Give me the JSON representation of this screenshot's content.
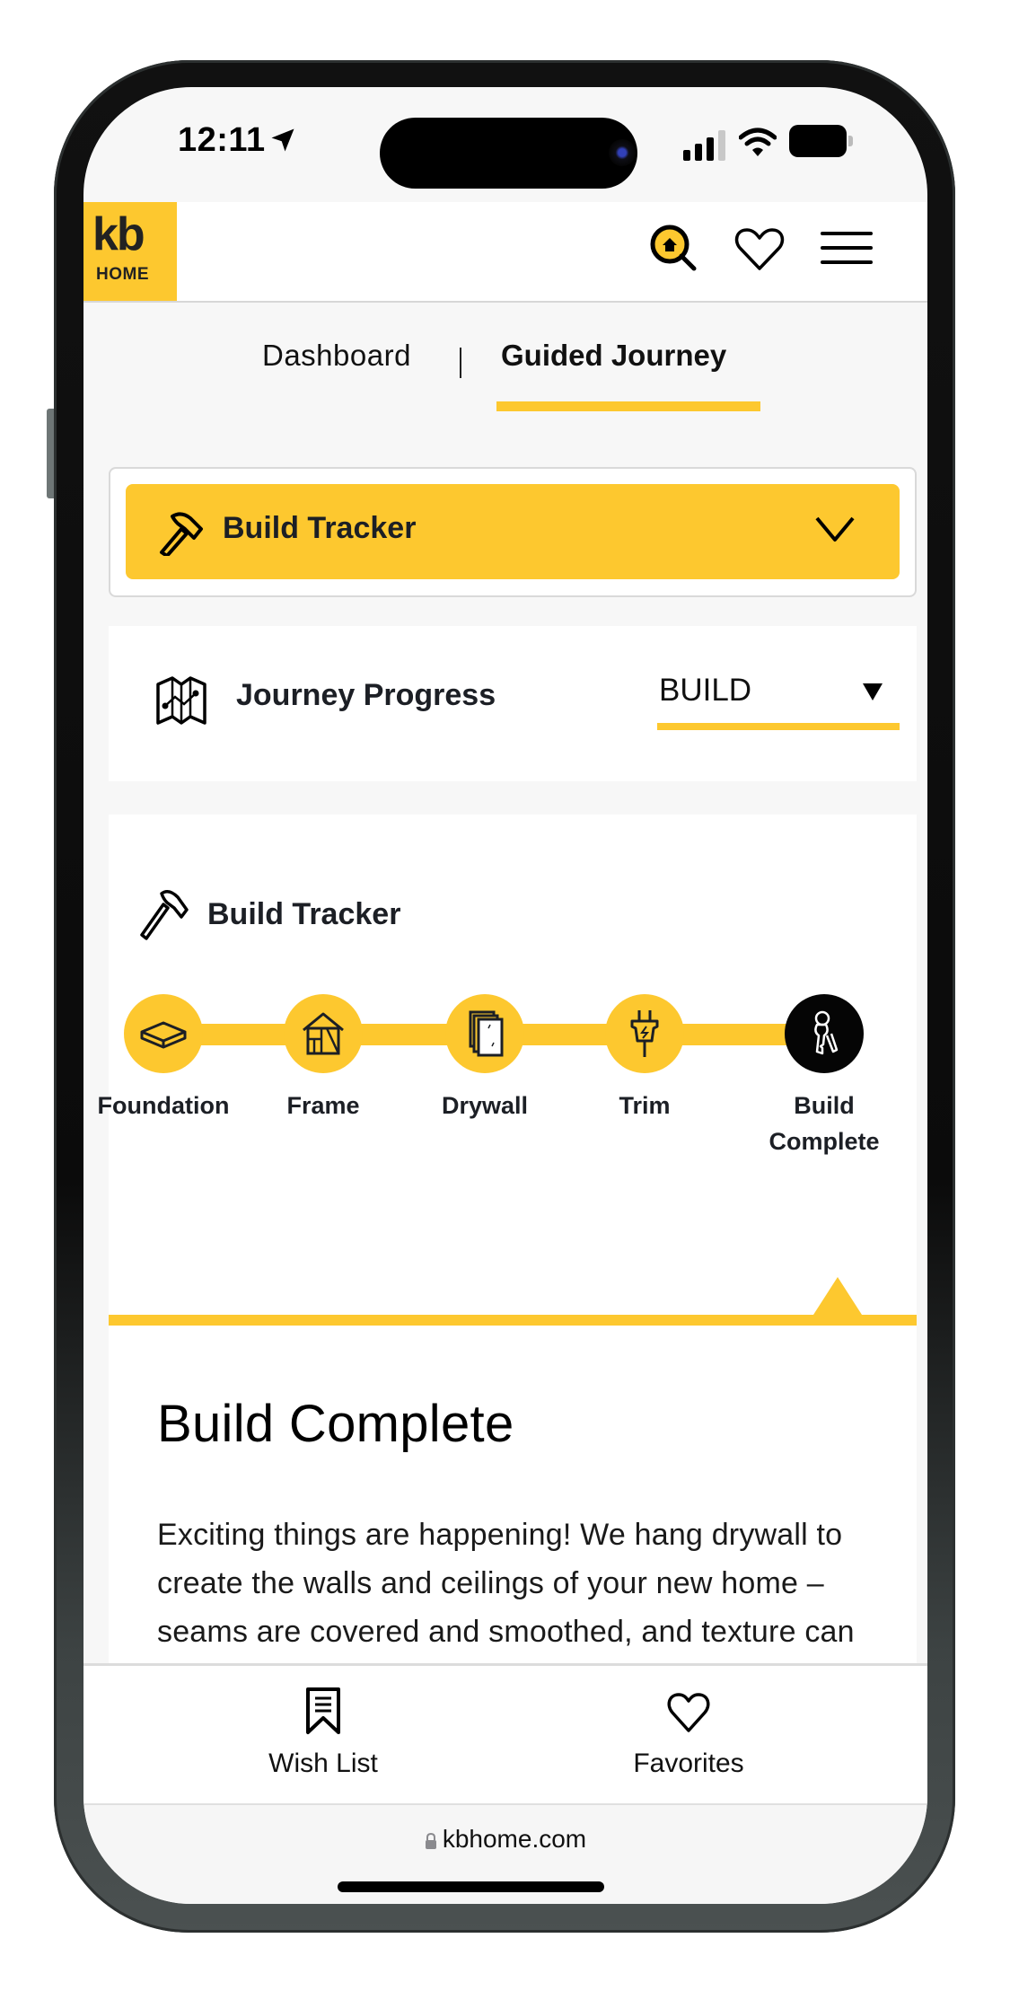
{
  "status_bar": {
    "time": "12:11",
    "icons": [
      "location-arrow-icon",
      "signal-icon",
      "wifi-icon",
      "battery-icon"
    ]
  },
  "header": {
    "logo": {
      "line1": "kb",
      "line2": "HOME"
    },
    "icons": [
      "home-search-icon",
      "heart-icon",
      "hamburger-menu-icon"
    ],
    "brand_color": "#fdc82f"
  },
  "tabs": {
    "items": [
      {
        "label": "Dashboard",
        "active": false
      },
      {
        "label": "Guided Journey",
        "active": true
      }
    ]
  },
  "section_dropdown": {
    "label": "Build Tracker",
    "icon": "hammer-icon",
    "expand_icon": "chevron-down-icon"
  },
  "journey_progress": {
    "label": "Journey Progress",
    "icon": "map-icon",
    "select_value": "BUILD"
  },
  "tracker": {
    "title": "Build Tracker",
    "steps": [
      {
        "label": "Foundation",
        "icon": "foundation-slab-icon",
        "active": false
      },
      {
        "label": "Frame",
        "icon": "house-frame-icon",
        "active": false
      },
      {
        "label": "Drywall",
        "icon": "drywall-sheets-icon",
        "active": false
      },
      {
        "label": "Trim",
        "icon": "electric-plug-icon",
        "active": false
      },
      {
        "label": "Build Complete",
        "label_lines": [
          "Build",
          "Complete"
        ],
        "icon": "keys-icon",
        "active": true
      }
    ],
    "detail": {
      "title": "Build Complete",
      "body": "Exciting things are happening! We hang drywall to create the walls and ceilings of your new home – seams are covered and smoothed, and texture can be applied for a more dramatic effect."
    }
  },
  "bottom_nav": {
    "items": [
      {
        "label": "Wish List",
        "icon": "bookmark-list-icon"
      },
      {
        "label": "Favorites",
        "icon": "heart-icon"
      }
    ]
  },
  "browser": {
    "url": "kbhome.com"
  }
}
